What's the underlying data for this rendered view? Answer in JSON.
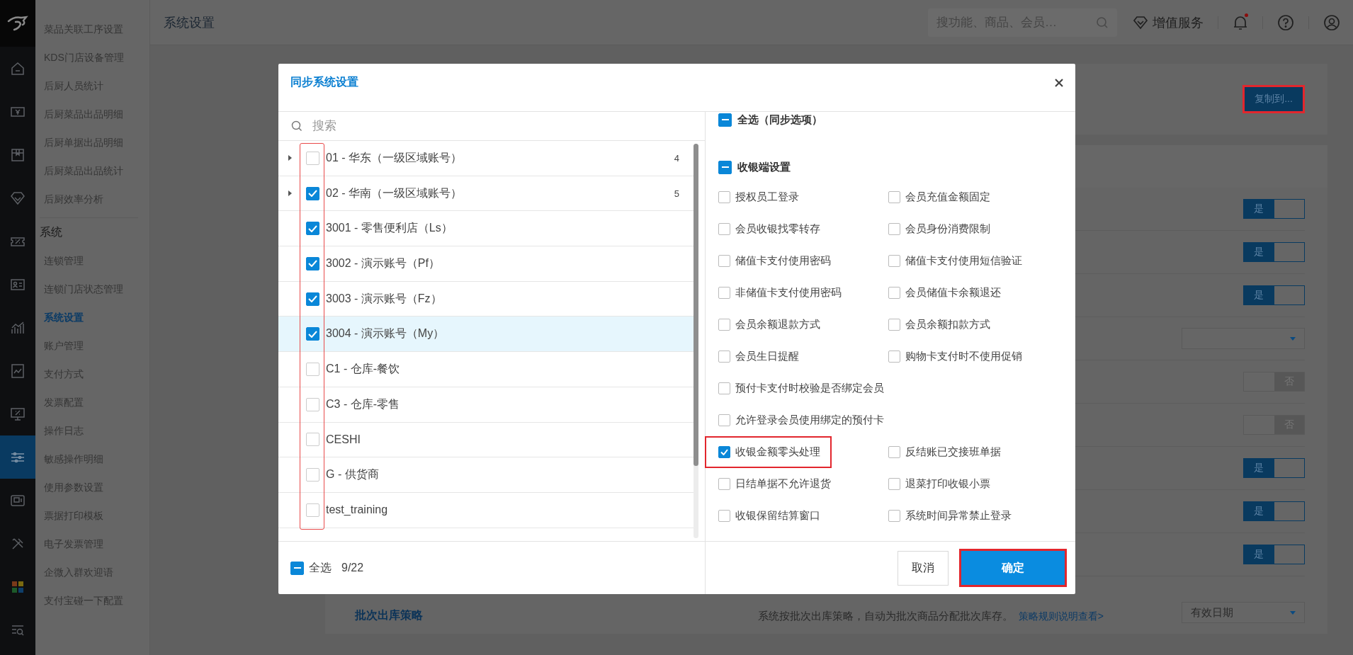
{
  "rail": [
    {
      "kind": "home",
      "selected": false
    },
    {
      "kind": "cash",
      "selected": false
    },
    {
      "kind": "box",
      "selected": false
    },
    {
      "kind": "diamond",
      "selected": false
    },
    {
      "kind": "ticket",
      "selected": false
    },
    {
      "kind": "idcard",
      "selected": false
    },
    {
      "kind": "chart",
      "selected": false
    },
    {
      "kind": "report",
      "selected": false
    },
    {
      "kind": "monitor",
      "selected": false
    },
    {
      "kind": "sliders",
      "selected": true
    },
    {
      "kind": "register",
      "selected": false
    },
    {
      "kind": "tools",
      "selected": false
    },
    {
      "kind": "apps",
      "selected": false
    },
    {
      "kind": "menu_search",
      "selected": false
    }
  ],
  "nav": {
    "items": [
      {
        "label": "菜品关联工序设置",
        "selected": false
      },
      {
        "label": "KDS门店设备管理",
        "selected": false
      },
      {
        "label": "后厨人员统计",
        "selected": false
      },
      {
        "label": "后厨菜品出品明细",
        "selected": false
      },
      {
        "label": "后厨单据出品明细",
        "selected": false
      },
      {
        "label": "后厨菜品出品统计",
        "selected": false
      },
      {
        "label": "后厨效率分析",
        "selected": false
      }
    ],
    "section_title": "系统",
    "section_items": [
      {
        "label": "连锁管理",
        "selected": false
      },
      {
        "label": "连锁门店状态管理",
        "selected": false
      },
      {
        "label": "系统设置",
        "selected": true
      },
      {
        "label": "账户管理",
        "selected": false
      },
      {
        "label": "支付方式",
        "selected": false
      },
      {
        "label": "发票配置",
        "selected": false
      },
      {
        "label": "操作日志",
        "selected": false
      },
      {
        "label": "敏感操作明细",
        "selected": false
      },
      {
        "label": "使用参数设置",
        "selected": false
      },
      {
        "label": "票据打印模板",
        "selected": false
      },
      {
        "label": "电子发票管理",
        "selected": false
      },
      {
        "label": "企微入群欢迎语",
        "selected": false
      },
      {
        "label": "支付宝碰一下配置",
        "selected": false
      }
    ]
  },
  "header": {
    "title": "系统设置",
    "search": {
      "placeholder": "搜功能、商品、会员…"
    },
    "value_added": "增值服务",
    "unread": true
  },
  "copy_button": {
    "label": "复制到...",
    "highlighted": true
  },
  "settings_rows": [
    {
      "kind": "switch",
      "on": true,
      "label": "是"
    },
    {
      "kind": "switch",
      "on": true,
      "label": "是"
    },
    {
      "kind": "switch",
      "on": true,
      "label": "是"
    },
    {
      "kind": "select"
    },
    {
      "kind": "switch",
      "on": false,
      "label": "否"
    },
    {
      "kind": "switch",
      "on": false,
      "label": "否"
    },
    {
      "kind": "switch",
      "on": true,
      "label": "是"
    },
    {
      "kind": "switch",
      "on": true,
      "label": "是"
    },
    {
      "kind": "switch",
      "on": true,
      "label": "是"
    },
    {
      "kind": "strategy",
      "name": "批次出库策略",
      "description": "系统按批次出库策略，自动为批次商品分配批次库存。",
      "link": "策略规则说明查看>",
      "value": "有效日期"
    }
  ],
  "dialog": {
    "title": "同步系统设置",
    "search": {
      "placeholder": "搜索"
    },
    "checkbox_column_highlighted": true,
    "accounts": [
      {
        "label": "01 - 华东（一级区域账号）",
        "count": "4",
        "expandable": true,
        "checked": false,
        "selected": false
      },
      {
        "label": "02 - 华南（一级区域账号）",
        "count": "5",
        "expandable": true,
        "checked": true,
        "selected": false
      },
      {
        "label": "3001 - 零售便利店（Ls）",
        "expandable": false,
        "checked": true,
        "selected": false
      },
      {
        "label": "3002 - 演示账号（Pf）",
        "expandable": false,
        "checked": true,
        "selected": false
      },
      {
        "label": "3003 - 演示账号（Fz）",
        "expandable": false,
        "checked": true,
        "selected": false
      },
      {
        "label": "3004 - 演示账号（My）",
        "expandable": false,
        "checked": true,
        "selected": true
      },
      {
        "label": "C1 - 仓库-餐饮",
        "expandable": false,
        "checked": false,
        "selected": false
      },
      {
        "label": "C3 - 仓库-零售",
        "expandable": false,
        "checked": false,
        "selected": false
      },
      {
        "label": "CESHI",
        "expandable": false,
        "checked": false,
        "selected": false
      },
      {
        "label": "G - 供货商",
        "expandable": false,
        "checked": false,
        "selected": false
      },
      {
        "label": "test_training",
        "expandable": false,
        "checked": false,
        "selected": false
      }
    ],
    "select_all": {
      "label": "全选",
      "partial": true,
      "count": "9/22"
    },
    "options_all": {
      "label": "全选（同步选项）",
      "partial": true
    },
    "group": {
      "label": "收银端设置",
      "partial": true,
      "options": [
        {
          "label": "授权员工登录",
          "kind": "half",
          "checked": false,
          "highlighted": false
        },
        {
          "label": "会员充值金额固定",
          "kind": "half",
          "checked": false,
          "highlighted": false
        },
        {
          "label": "会员收银找零转存",
          "kind": "half",
          "checked": false,
          "highlighted": false
        },
        {
          "label": "会员身份消费限制",
          "kind": "half",
          "checked": false,
          "highlighted": false
        },
        {
          "label": "储值卡支付使用密码",
          "kind": "half",
          "checked": false,
          "highlighted": false
        },
        {
          "label": "储值卡支付使用短信验证",
          "kind": "half",
          "checked": false,
          "highlighted": false
        },
        {
          "label": "非储值卡支付使用密码",
          "kind": "half",
          "checked": false,
          "highlighted": false
        },
        {
          "label": "会员储值卡余额退还",
          "kind": "half",
          "checked": false,
          "highlighted": false
        },
        {
          "label": "会员余额退款方式",
          "kind": "half",
          "checked": false,
          "highlighted": false
        },
        {
          "label": "会员余额扣款方式",
          "kind": "half",
          "checked": false,
          "highlighted": false
        },
        {
          "label": "会员生日提醒",
          "kind": "half",
          "checked": false,
          "highlighted": false
        },
        {
          "label": "购物卡支付时不使用促销",
          "kind": "half",
          "checked": false,
          "highlighted": false
        },
        {
          "label": "预付卡支付时校验是否绑定会员",
          "kind": "wide",
          "checked": false,
          "highlighted": false
        },
        {
          "label": "允许登录会员使用绑定的预付卡",
          "kind": "wide",
          "checked": false,
          "highlighted": false
        },
        {
          "label": "收银金额零头处理",
          "kind": "half",
          "checked": true,
          "highlighted": true
        },
        {
          "label": "反结账已交接班单据",
          "kind": "half",
          "checked": false,
          "highlighted": false
        },
        {
          "label": "日结单据不允许退货",
          "kind": "half",
          "checked": false,
          "highlighted": false
        },
        {
          "label": "退菜打印收银小票",
          "kind": "half",
          "checked": false,
          "highlighted": false
        },
        {
          "label": "收银保留结算窗口",
          "kind": "half",
          "checked": false,
          "highlighted": false
        },
        {
          "label": "系统时间异常禁止登录",
          "kind": "half",
          "checked": false,
          "highlighted": false
        }
      ]
    },
    "buttons": [
      {
        "kind": "cancel",
        "label": "取消",
        "highlighted": false
      },
      {
        "kind": "confirm",
        "label": "确定",
        "highlighted": true
      }
    ]
  }
}
